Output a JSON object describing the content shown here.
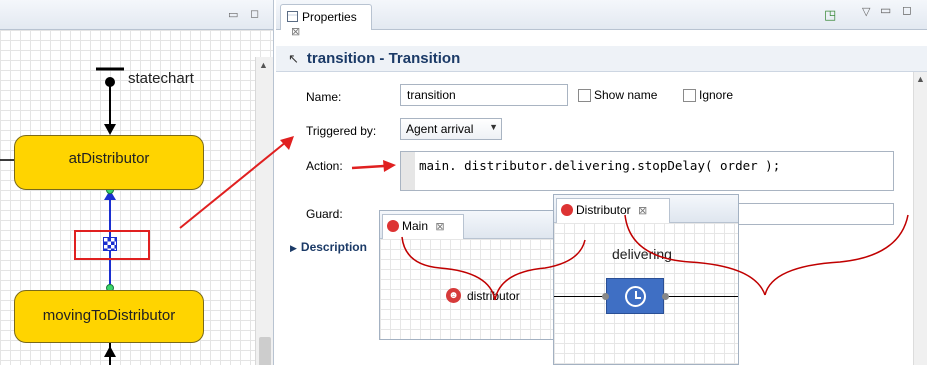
{
  "left_editor": {
    "statechart_label": "statechart",
    "states": [
      "atDistributor",
      "movingToDistributor"
    ]
  },
  "properties": {
    "tab_label": "Properties",
    "title": "transition - Transition",
    "fields": {
      "name_label": "Name:",
      "name_value": "transition",
      "show_name_label": "Show name",
      "ignore_label": "Ignore",
      "triggered_by_label": "Triggered by:",
      "triggered_by_value": "Agent arrival",
      "action_label": "Action:",
      "action_code": "main. distributor.delivering.stopDelay( order );",
      "guard_label": "Guard:"
    },
    "description_label": "Description"
  },
  "main_popup": {
    "tab_label": "Main",
    "element_label": "distributor"
  },
  "distributor_popup": {
    "tab_label": "Distributor",
    "block_label": "delivering"
  },
  "colors": {
    "state_fill": "#ffd400",
    "annotation_red": "#e02020",
    "transition_blue": "#1a2fd0",
    "delay_block": "#3f6fc4"
  }
}
